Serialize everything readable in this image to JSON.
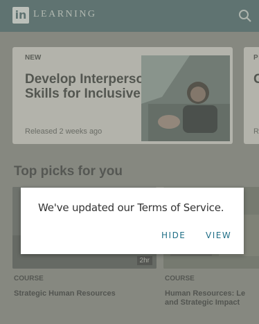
{
  "header": {
    "logo": "in",
    "brand": "LEARNING",
    "search_icon": "search-icon"
  },
  "featured": [
    {
      "badge": "NEW",
      "title": "Develop Interpersonal Skills for Inclusive...",
      "meta": "Released 2 weeks ago"
    },
    {
      "badge": "P",
      "title": "G th E",
      "meta": "R"
    }
  ],
  "section": {
    "title": "Top picks for you"
  },
  "courses": [
    {
      "label": "COURSE",
      "title": "Strategic Human Resources",
      "duration": "2hr"
    },
    {
      "label": "COURSE",
      "title": "Human Resources: Le and Strategic Impact"
    }
  ],
  "dialog": {
    "message": "We've updated our Terms of Service.",
    "hide_label": "HIDE",
    "view_label": "VIEW"
  },
  "colors": {
    "header": "#4f6e70",
    "dialog_button": "#1f6e86",
    "scrim": "#8e9088"
  }
}
